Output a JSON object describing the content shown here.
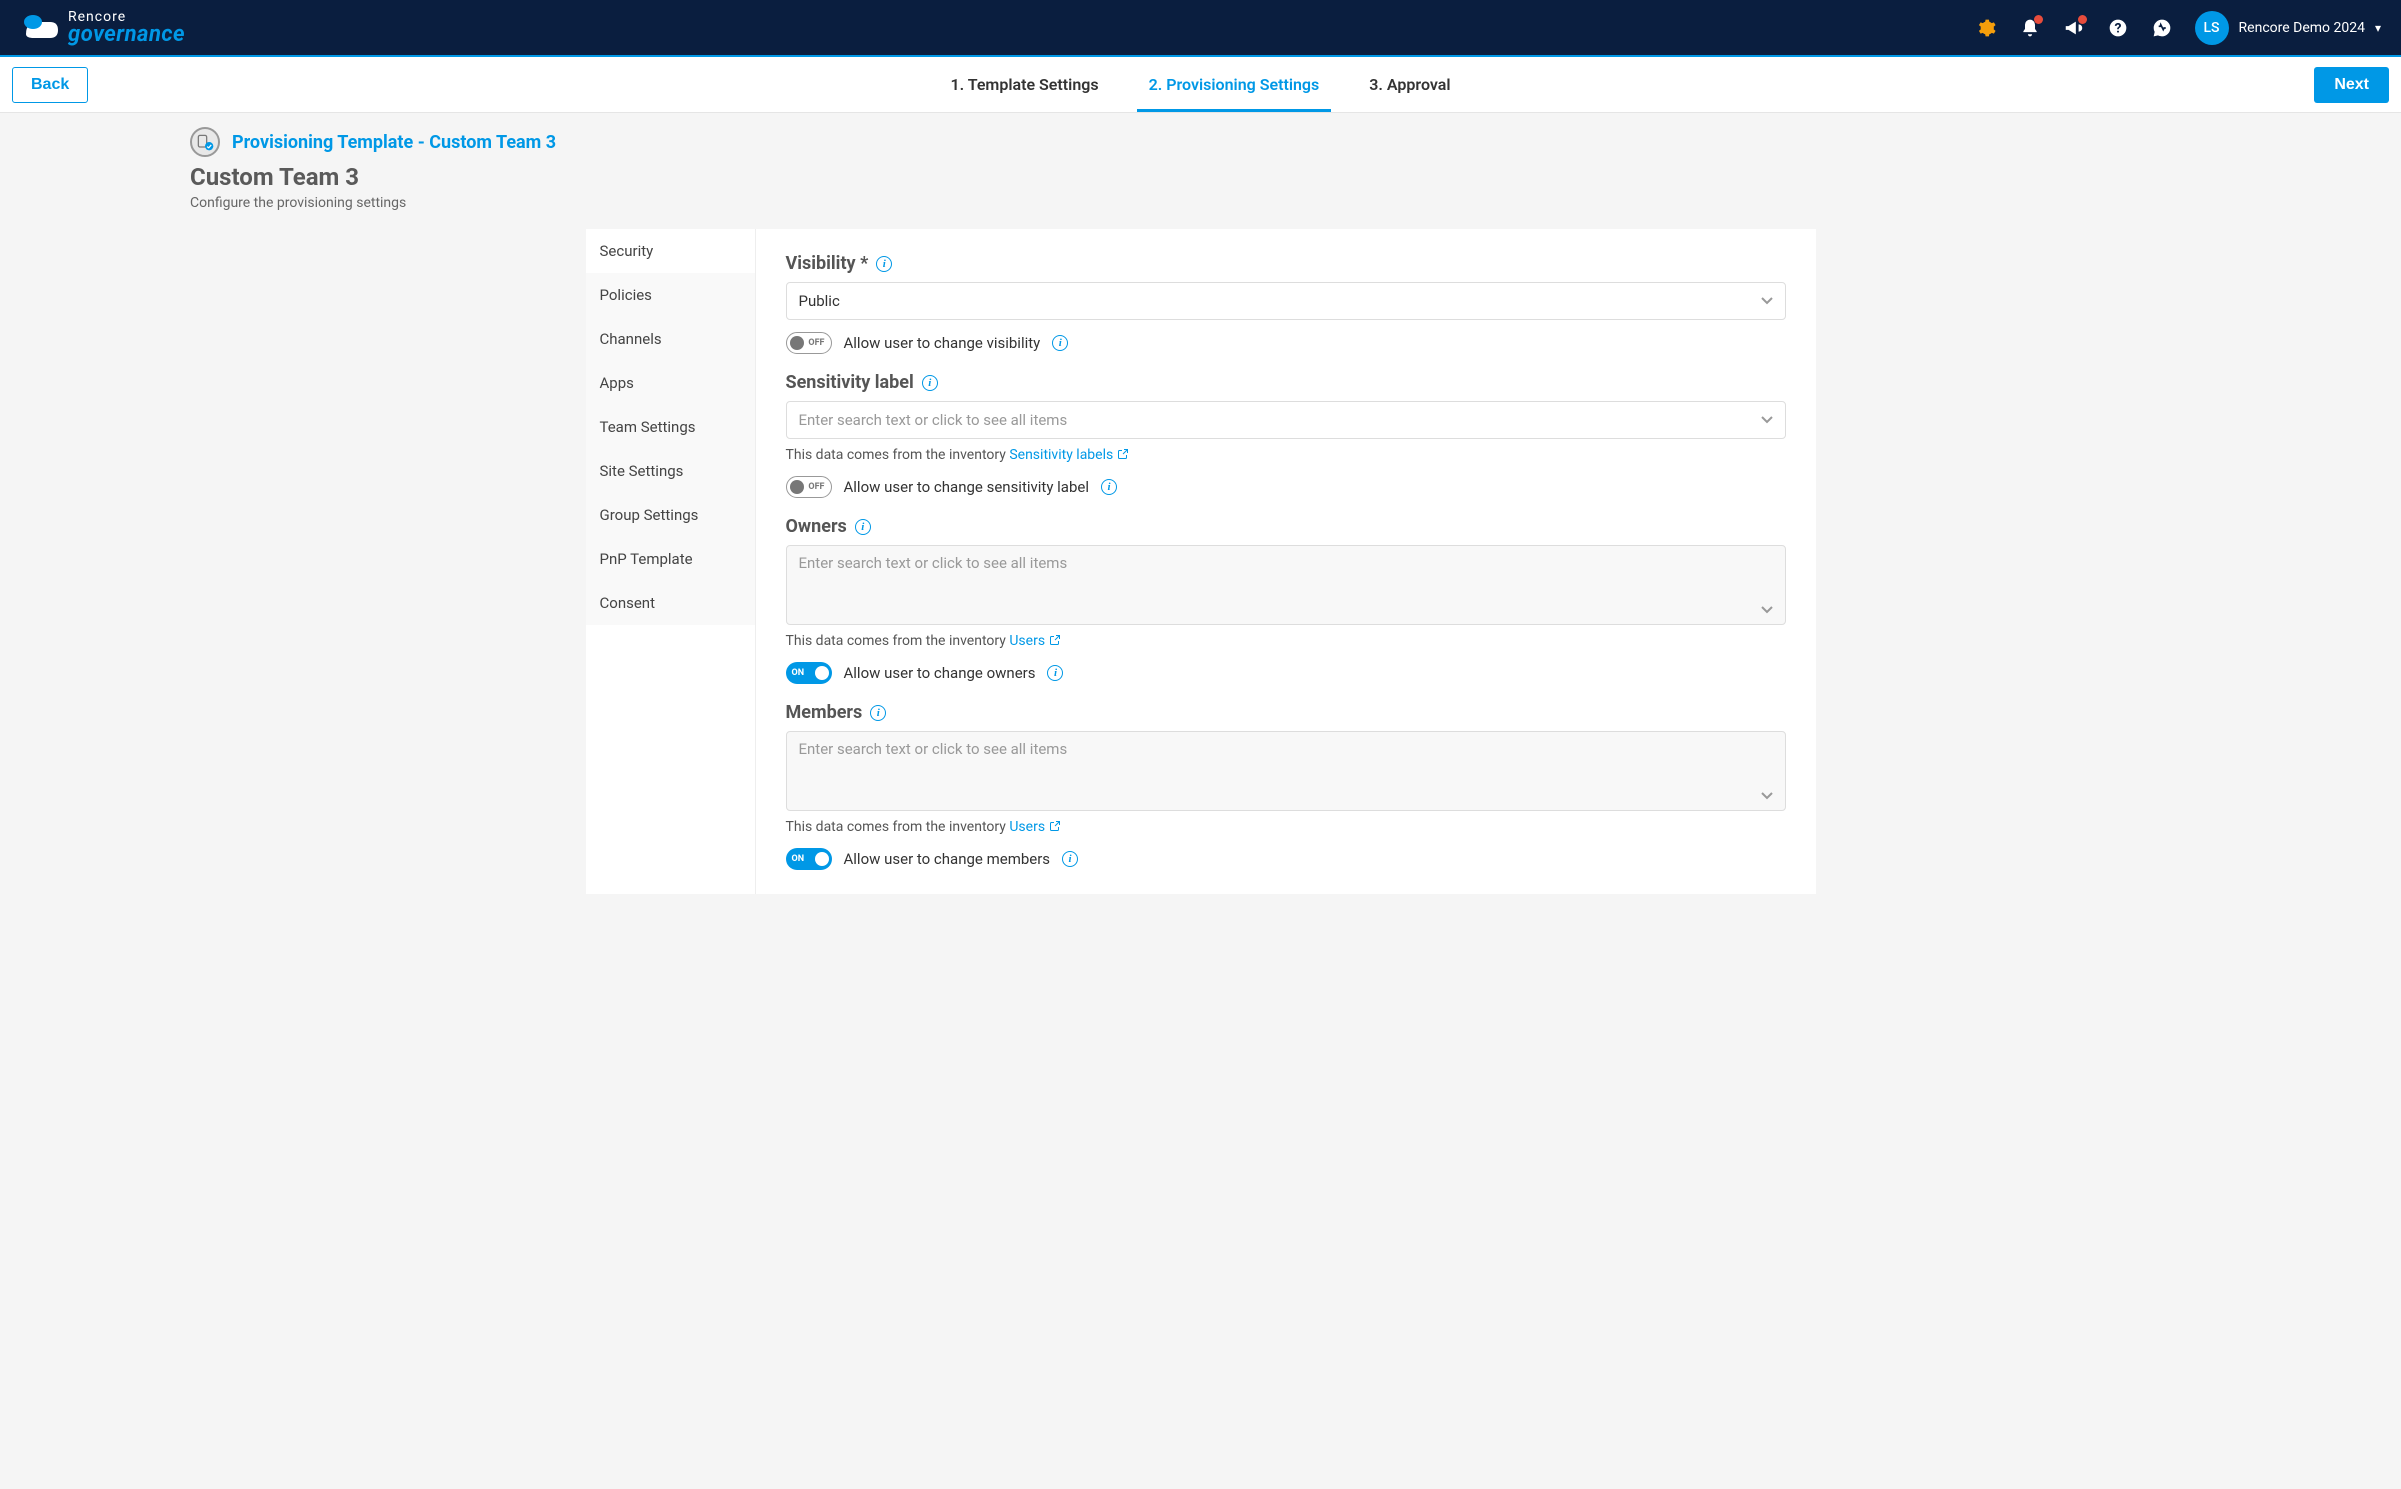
{
  "header": {
    "brand_top": "Rencore",
    "brand_bottom": "governance",
    "user_initials": "LS",
    "user_label": "Rencore Demo 2024"
  },
  "stepbar": {
    "back_label": "Back",
    "next_label": "Next",
    "steps": [
      "1. Template Settings",
      "2. Provisioning Settings",
      "3. Approval"
    ]
  },
  "page": {
    "breadcrumb": "Provisioning Template - Custom Team 3",
    "title": "Custom Team 3",
    "subtitle": "Configure the provisioning settings"
  },
  "sidebar": {
    "items": [
      "Security",
      "Policies",
      "Channels",
      "Apps",
      "Team Settings",
      "Site Settings",
      "Group Settings",
      "PnP Template",
      "Consent"
    ]
  },
  "form": {
    "visibility": {
      "label": "Visibility *",
      "value": "Public",
      "toggle_label": "Allow user to change visibility",
      "toggle_state": "OFF"
    },
    "sensitivity": {
      "label": "Sensitivity label",
      "placeholder": "Enter search text or click to see all items",
      "helper_prefix": "This data comes from the inventory ",
      "helper_link": "Sensitivity labels",
      "toggle_label": "Allow user to change sensitivity label",
      "toggle_state": "OFF"
    },
    "owners": {
      "label": "Owners",
      "placeholder": "Enter search text or click to see all items",
      "helper_prefix": "This data comes from the inventory ",
      "helper_link": "Users",
      "toggle_label": "Allow user to change owners",
      "toggle_state": "ON"
    },
    "members": {
      "label": "Members",
      "placeholder": "Enter search text or click to see all items",
      "helper_prefix": "This data comes from the inventory ",
      "helper_link": "Users",
      "toggle_label": "Allow user to change members",
      "toggle_state": "ON"
    }
  }
}
